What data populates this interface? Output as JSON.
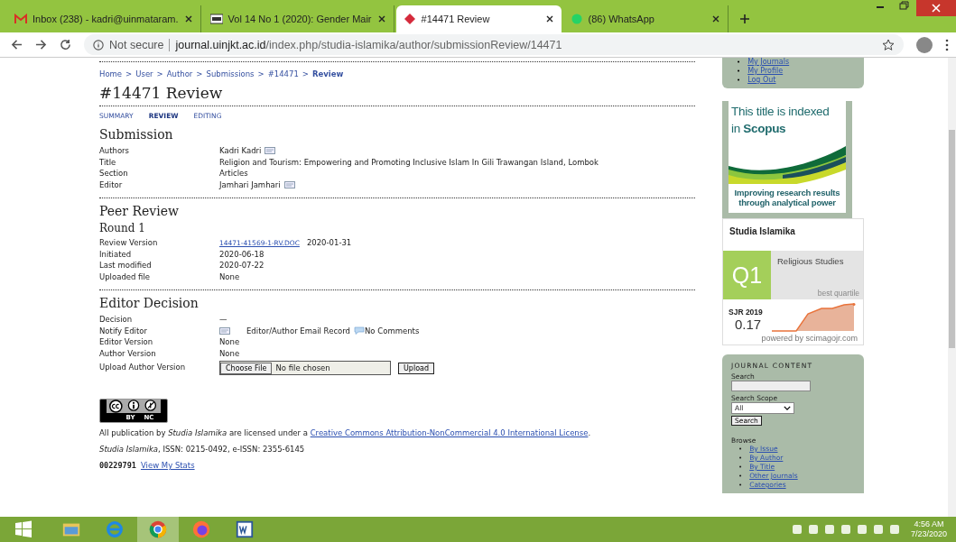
{
  "browser": {
    "tabs": [
      {
        "title": "Inbox (238) - kadri@uinmataram.",
        "selected": false
      },
      {
        "title": "Vol 14 No 1 (2020): Gender Mair",
        "selected": false
      },
      {
        "title": "#14471 Review",
        "selected": true
      },
      {
        "title": "(86) WhatsApp",
        "selected": false
      }
    ],
    "security": "Not secure",
    "url_host": "journal.uinjkt.ac.id",
    "url_path": "/index.php/studia-islamika/author/submissionReview/14471"
  },
  "breadcrumb": [
    {
      "label": "Home",
      "current": false
    },
    {
      "label": "User",
      "current": false
    },
    {
      "label": "Author",
      "current": false
    },
    {
      "label": "Submissions",
      "current": false
    },
    {
      "label": "#14471",
      "current": false
    },
    {
      "label": "Review",
      "current": true
    }
  ],
  "breadcrumb_separator": ">",
  "title": "#14471 Review",
  "subnav": [
    {
      "label": "SUMMARY",
      "selected": false
    },
    {
      "label": "REVIEW",
      "selected": true
    },
    {
      "label": "EDITING",
      "selected": false
    }
  ],
  "submission": {
    "heading": "Submission",
    "rows": [
      {
        "label": "Authors",
        "value": "Kadri Kadri",
        "email": true
      },
      {
        "label": "Title",
        "value": "Religion and Tourism: Empowering and Promoting Inclusive Islam In Gili Trawangan Island, Lombok",
        "email": false
      },
      {
        "label": "Section",
        "value": "Articles",
        "email": false
      },
      {
        "label": "Editor",
        "value": "Jamhari Jamhari",
        "email": true
      }
    ]
  },
  "peer_review": {
    "heading": "Peer Review",
    "round": "Round 1",
    "review_version": {
      "label": "Review Version",
      "file": "14471-41569-1-RV.DOC",
      "date": "2020-01-31"
    },
    "rows": [
      {
        "label": "Initiated",
        "value": "2020-06-18"
      },
      {
        "label": "Last modified",
        "value": "2020-07-22"
      },
      {
        "label": "Uploaded file",
        "value": "None"
      }
    ]
  },
  "editor_decision": {
    "heading": "Editor Decision",
    "decision": {
      "label": "Decision",
      "value": "—"
    },
    "notify": {
      "label": "Notify Editor",
      "record": "Editor/Author Email Record",
      "comments": "No Comments"
    },
    "rows": [
      {
        "label": "Editor Version",
        "value": "None"
      },
      {
        "label": "Author Version",
        "value": "None"
      }
    ],
    "upload": {
      "label": "Upload Author Version",
      "choose": "Choose File",
      "status": "No file chosen",
      "button": "Upload"
    }
  },
  "footer": {
    "cc_by": "BY",
    "cc_nc": "NC",
    "license_pre": "All publication by",
    "journal": "Studia Islamika",
    "license_mid": "are licensed under a",
    "license_link": "Creative Commons Attribution-NonCommercial 4.0 International License",
    "license_end": ".",
    "journal_issn": "Studia Islamika",
    "issn": ", ISSN: 0215-0492, e-ISSN: 2355-6145",
    "counter": "00229791",
    "stats_link": "View My Stats"
  },
  "sidebar": {
    "bullet": "•",
    "user_links": [
      "My Journals",
      "My Profile",
      "Log Out"
    ],
    "scopus": {
      "line1": "This title is indexed",
      "line2_pre": "in",
      "line2_bold": "Scopus",
      "tagline": "Improving research results through analytical power"
    },
    "sjr": {
      "journal": "Studia Islamika",
      "quartile": "Q1",
      "category": "Religious Studies",
      "quartile_note": "best quartile",
      "sjr_label": "SJR 2019",
      "sjr_value": "0.17",
      "powered": "powered by scimagojr.com"
    },
    "journal_content": {
      "heading": "JOURNAL CONTENT",
      "search_label": "Search",
      "scope_label": "Search Scope",
      "scope_value": "All",
      "search_button": "Search",
      "browse_label": "Browse",
      "browse_links": [
        "By Issue",
        "By Author",
        "By Title",
        "Other Journals",
        "Categories"
      ]
    }
  },
  "taskbar": {
    "apps": [
      {
        "kind": "explorer",
        "selected": false
      },
      {
        "kind": "ie",
        "selected": false
      },
      {
        "kind": "chrome",
        "selected": true
      },
      {
        "kind": "firefox",
        "selected": false
      },
      {
        "kind": "word",
        "selected": false
      }
    ],
    "time": "4:56 AM",
    "date": "7/23/2020"
  }
}
